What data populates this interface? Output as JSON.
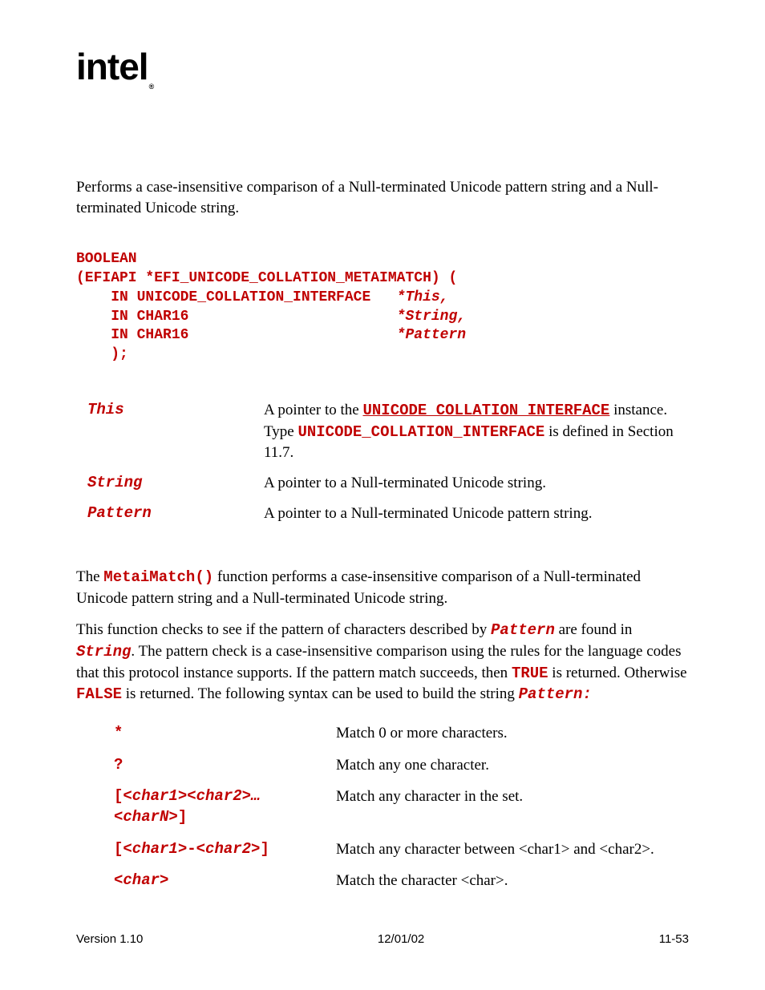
{
  "logo": "intel",
  "summary": "Performs a case-insensitive comparison of a Null-terminated Unicode pattern string and a Null-terminated Unicode string.",
  "code": {
    "l1a": "BOOLEAN",
    "l2a": "(EFIAPI *EFI_UNICODE_COLLATION_METAIMATCH) (",
    "l3a": "    IN UNICODE_COLLATION_INTERFACE   ",
    "l3b": "*This,",
    "l4a": "    IN CHAR16                        ",
    "l4b": "*String,",
    "l5a": "    IN CHAR16                        ",
    "l5b": "*Pattern",
    "l6a": "    );"
  },
  "params": [
    {
      "name": "This",
      "desc_pre": "A pointer to the ",
      "desc_link": "UNICODE_COLLATION_INTERFACE",
      "desc_mid": " instance.  Type ",
      "desc_code": "UNICODE_COLLATION_INTERFACE",
      "desc_post": " is defined in Section 11.7."
    },
    {
      "name": "String",
      "desc_plain": "A pointer to a Null-terminated Unicode string."
    },
    {
      "name": "Pattern",
      "desc_plain": "A pointer to a Null-terminated Unicode pattern string."
    }
  ],
  "desc": {
    "p1_a": "The ",
    "p1_fn": "MetaiMatch()",
    "p1_b": " function performs a case-insensitive comparison of a Null-terminated Unicode pattern string and a Null-terminated Unicode string.",
    "p2_a": "This function checks to see if the pattern of characters described by ",
    "p2_pat": "Pattern",
    "p2_b": " are found in ",
    "p2_str": "String",
    "p2_c": ".  The pattern check is a case-insensitive comparison using the rules for the language codes that this protocol instance supports.  If the pattern match succeeds, then ",
    "p2_true": "TRUE",
    "p2_d": " is returned.  Otherwise ",
    "p2_false": "FALSE",
    "p2_e": " is returned.  The following syntax can be used to build the string ",
    "p2_pat2": "Pattern",
    "p2_f": ":"
  },
  "syntax": [
    {
      "sym": "*",
      "text": "Match 0 or more characters."
    },
    {
      "sym": "?",
      "text": "Match any one character."
    },
    {
      "sym_open": "[",
      "sym_it": "<char1><char2>…<charN>",
      "sym_close": "]",
      "text": "Match any character in the set."
    },
    {
      "sym_open": "[",
      "sym_it": "<char1>",
      "sym_mid": "-",
      "sym_it2": "<char2>",
      "sym_close": "]",
      "text": "Match any character between <char1> and <char2>."
    },
    {
      "sym_it_only": "<char>",
      "text": "Match the character <char>."
    }
  ],
  "footer": {
    "version": "Version 1.10",
    "date": "12/01/02",
    "page": "11-53"
  }
}
